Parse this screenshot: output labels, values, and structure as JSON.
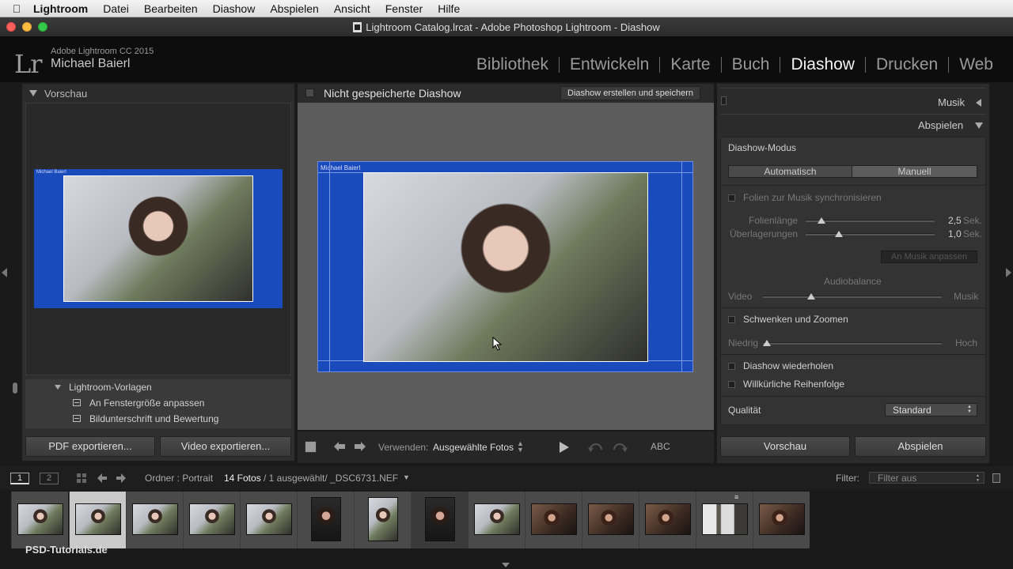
{
  "menubar": {
    "app": "Lightroom",
    "items": [
      "Datei",
      "Bearbeiten",
      "Diashow",
      "Abspielen",
      "Ansicht",
      "Fenster",
      "Hilfe"
    ]
  },
  "window": {
    "title": "Lightroom Catalog.lrcat - Adobe Photoshop Lightroom - Diashow"
  },
  "identity": {
    "logo": "Lr",
    "product": "Adobe Lightroom CC 2015",
    "user": "Michael Baierl"
  },
  "modules": [
    "Bibliothek",
    "Entwickeln",
    "Karte",
    "Buch",
    "Diashow",
    "Drucken",
    "Web"
  ],
  "left_panel": {
    "header": "Vorschau",
    "preview_caption": "Michael Baierl",
    "templates_folder": "Lightroom-Vorlagen",
    "templates": [
      "An Fenstergröße anpassen",
      "Bildunterschrift und Bewertung"
    ],
    "pdf_button": "PDF exportieren...",
    "video_button": "Video exportieren..."
  },
  "center": {
    "title": "Nicht gespeicherte Diashow",
    "create_button": "Diashow erstellen und speichern",
    "slide_caption": "Michael Baierl",
    "toolbar": {
      "use_label": "Verwenden:",
      "use_value": "Ausgewählte Fotos",
      "abc": "ABC"
    }
  },
  "right_panel": {
    "music_header": "Musik",
    "playback_header": "Abspielen",
    "mode_label": "Diashow-Modus",
    "mode_auto": "Automatisch",
    "mode_manual": "Manuell",
    "sync_label": "Folien zur Musik synchronisieren",
    "slide_length_label": "Folienlänge",
    "slide_length_value": "2,5",
    "overlap_label": "Überlagerungen",
    "overlap_value": "1,0",
    "unit": "Sek.",
    "fit_music_button": "An Musik anpassen",
    "audio_balance": "Audiobalance",
    "video_label": "Video",
    "music_label": "Musik",
    "pan_zoom_label": "Schwenken und Zoomen",
    "low_label": "Niedrig",
    "high_label": "Hoch",
    "repeat_label": "Diashow wiederholen",
    "random_label": "Willkürliche Reihenfolge",
    "quality_label": "Qualität",
    "quality_value": "Standard",
    "slide_length_fraction": 0.12,
    "overlap_fraction": 0.26,
    "balance_fraction": 0.27,
    "panzoom_fraction": 0.02,
    "preview_button": "Vorschau",
    "play_button": "Abspielen"
  },
  "filmstrip_bar": {
    "page1": "1",
    "page2": "2",
    "source": "Ordner : Portrait",
    "count": "14 Fotos",
    "selected": "/ 1 ausgewählt/ _DSC6731.NEF",
    "filter_label": "Filter:",
    "filter_value": "Filter aus"
  },
  "watermark": "PSD-Tutorials.de"
}
